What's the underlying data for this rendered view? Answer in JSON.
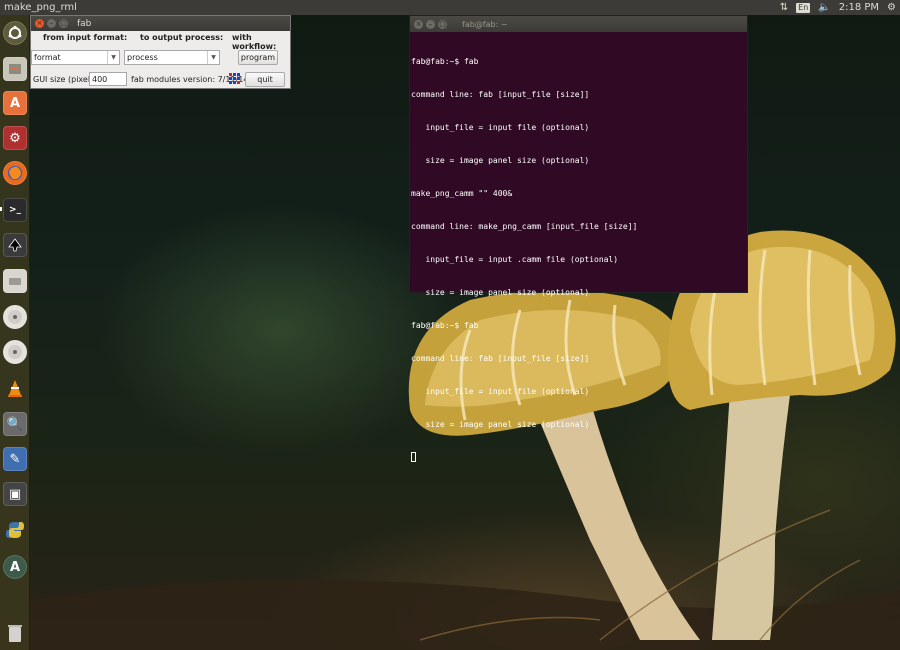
{
  "top_panel": {
    "app_title": "make_png_rml",
    "language_indicator": "En",
    "clock": "2:18 PM"
  },
  "launcher": {
    "items": [
      {
        "name": "ubuntu-dash",
        "icon": "ubuntu-logo-icon"
      },
      {
        "name": "files",
        "icon": "file-cabinet-icon"
      },
      {
        "name": "software-center",
        "icon": "software-bag-icon"
      },
      {
        "name": "system-settings",
        "icon": "gear-wrench-icon"
      },
      {
        "name": "firefox",
        "icon": "firefox-icon"
      },
      {
        "name": "terminal",
        "icon": "terminal-icon"
      },
      {
        "name": "inkscape",
        "icon": "inkscape-icon"
      },
      {
        "name": "drive",
        "icon": "drive-icon"
      },
      {
        "name": "disc-1",
        "icon": "cd-disc-icon"
      },
      {
        "name": "disc-2",
        "icon": "cd-disc-icon"
      },
      {
        "name": "vlc",
        "icon": "vlc-cone-icon"
      },
      {
        "name": "tool-1",
        "icon": "magnifier-tool-icon"
      },
      {
        "name": "tool-2",
        "icon": "screwdriver-icon"
      },
      {
        "name": "tool-3",
        "icon": "device-icon"
      },
      {
        "name": "python",
        "icon": "python-icon"
      },
      {
        "name": "updater",
        "icon": "update-manager-icon"
      },
      {
        "name": "trash",
        "icon": "trash-icon"
      }
    ]
  },
  "fab_window": {
    "title": "fab",
    "input_format_label": "from input format:",
    "output_process_label": "to output process:",
    "workflow_label": "with workflow:",
    "format_select_value": "format",
    "process_select_value": "process",
    "program_button": "program",
    "gui_size_label": "GUI size (pixels):",
    "gui_size_value": "400",
    "version_text": "fab modules version: 7/11/14",
    "quit_button": "quit",
    "colors": {
      "logo_red": "#e0201b",
      "logo_blue": "#1d3fd6"
    }
  },
  "terminal": {
    "title": "fab@fab: ~",
    "lines": [
      "fab@fab:~$ fab",
      "command line: fab [input_file [size]]",
      "   input_file = input file (optional)",
      "   size = image panel size (optional)",
      "make_png_camm \"\" 400&",
      "command line: make_png_camm [input_file [size]]",
      "   input_file = input .camm file (optional)",
      "   size = image panel size (optional)",
      "fab@fab:~$ fab",
      "command line: fab [input_file [size]]",
      "   input_file = input file (optional)",
      "   size = image panel size (optional)"
    ],
    "colors": {
      "background": "#300a24",
      "text": "#ffffff"
    }
  }
}
